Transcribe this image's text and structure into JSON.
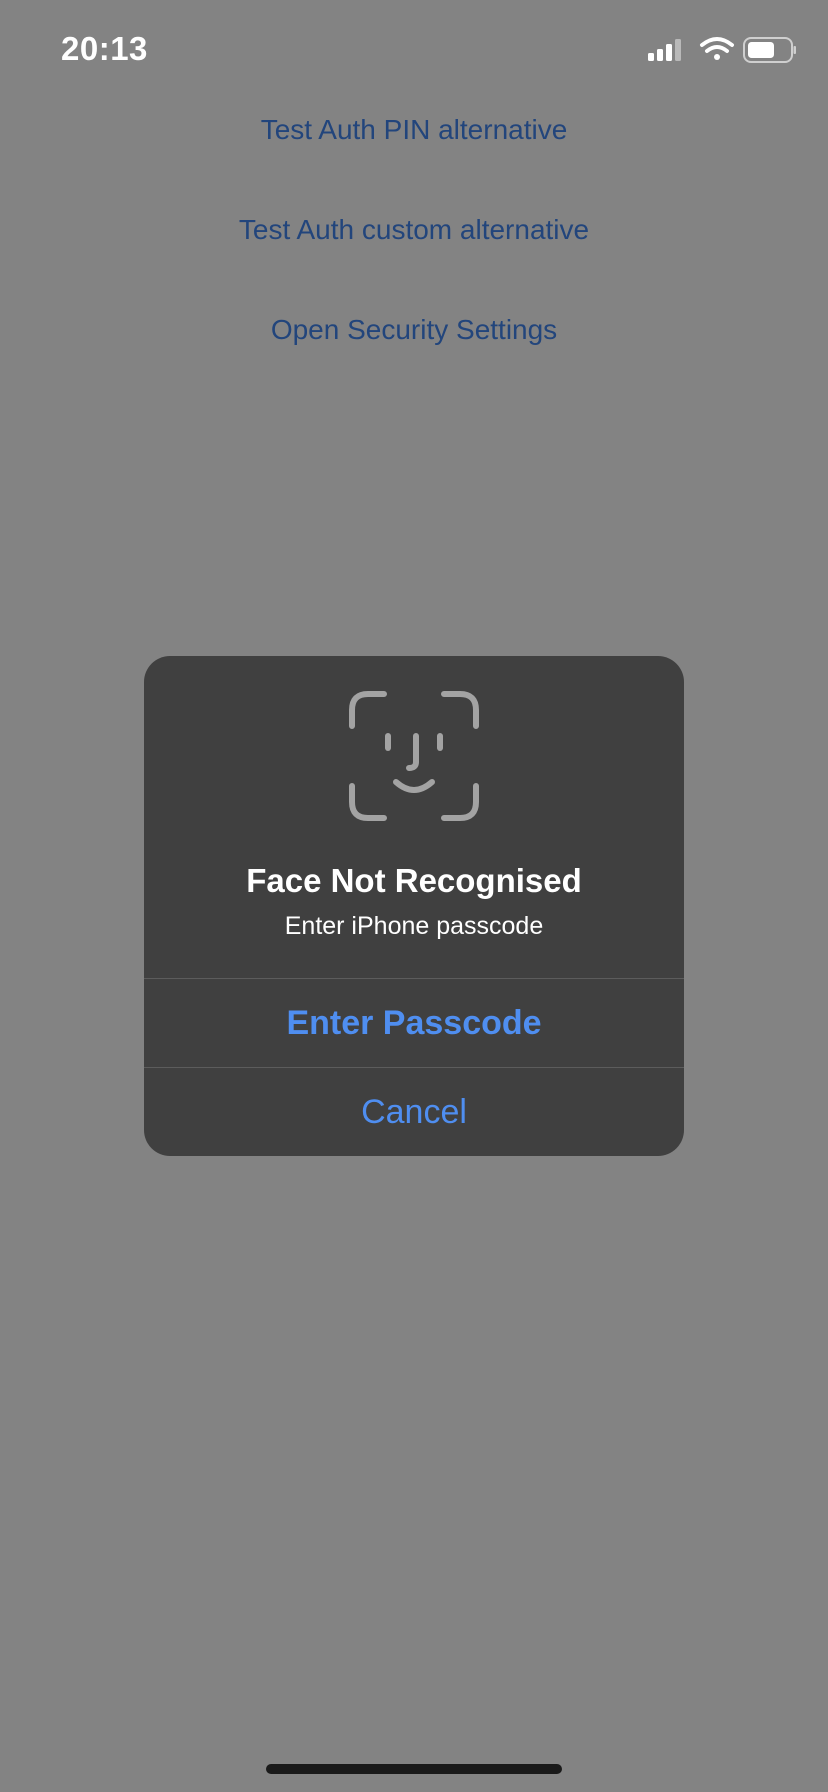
{
  "status_bar": {
    "time": "20:13",
    "icons": [
      "cellular-signal-icon",
      "wifi-icon",
      "battery-icon"
    ]
  },
  "menu": {
    "items": [
      {
        "label": "Test Auth PIN alternative"
      },
      {
        "label": "Test Auth custom alternative"
      },
      {
        "label": "Open Security Settings"
      }
    ]
  },
  "alert": {
    "icon": "face-id-icon",
    "title": "Face Not Recognised",
    "message": "Enter iPhone passcode",
    "primary_button": "Enter Passcode",
    "cancel_button": "Cancel"
  },
  "colors": {
    "background": "#838383",
    "link": "#22457c",
    "alert_background": "#404040",
    "alert_button": "#4f8ef0"
  }
}
